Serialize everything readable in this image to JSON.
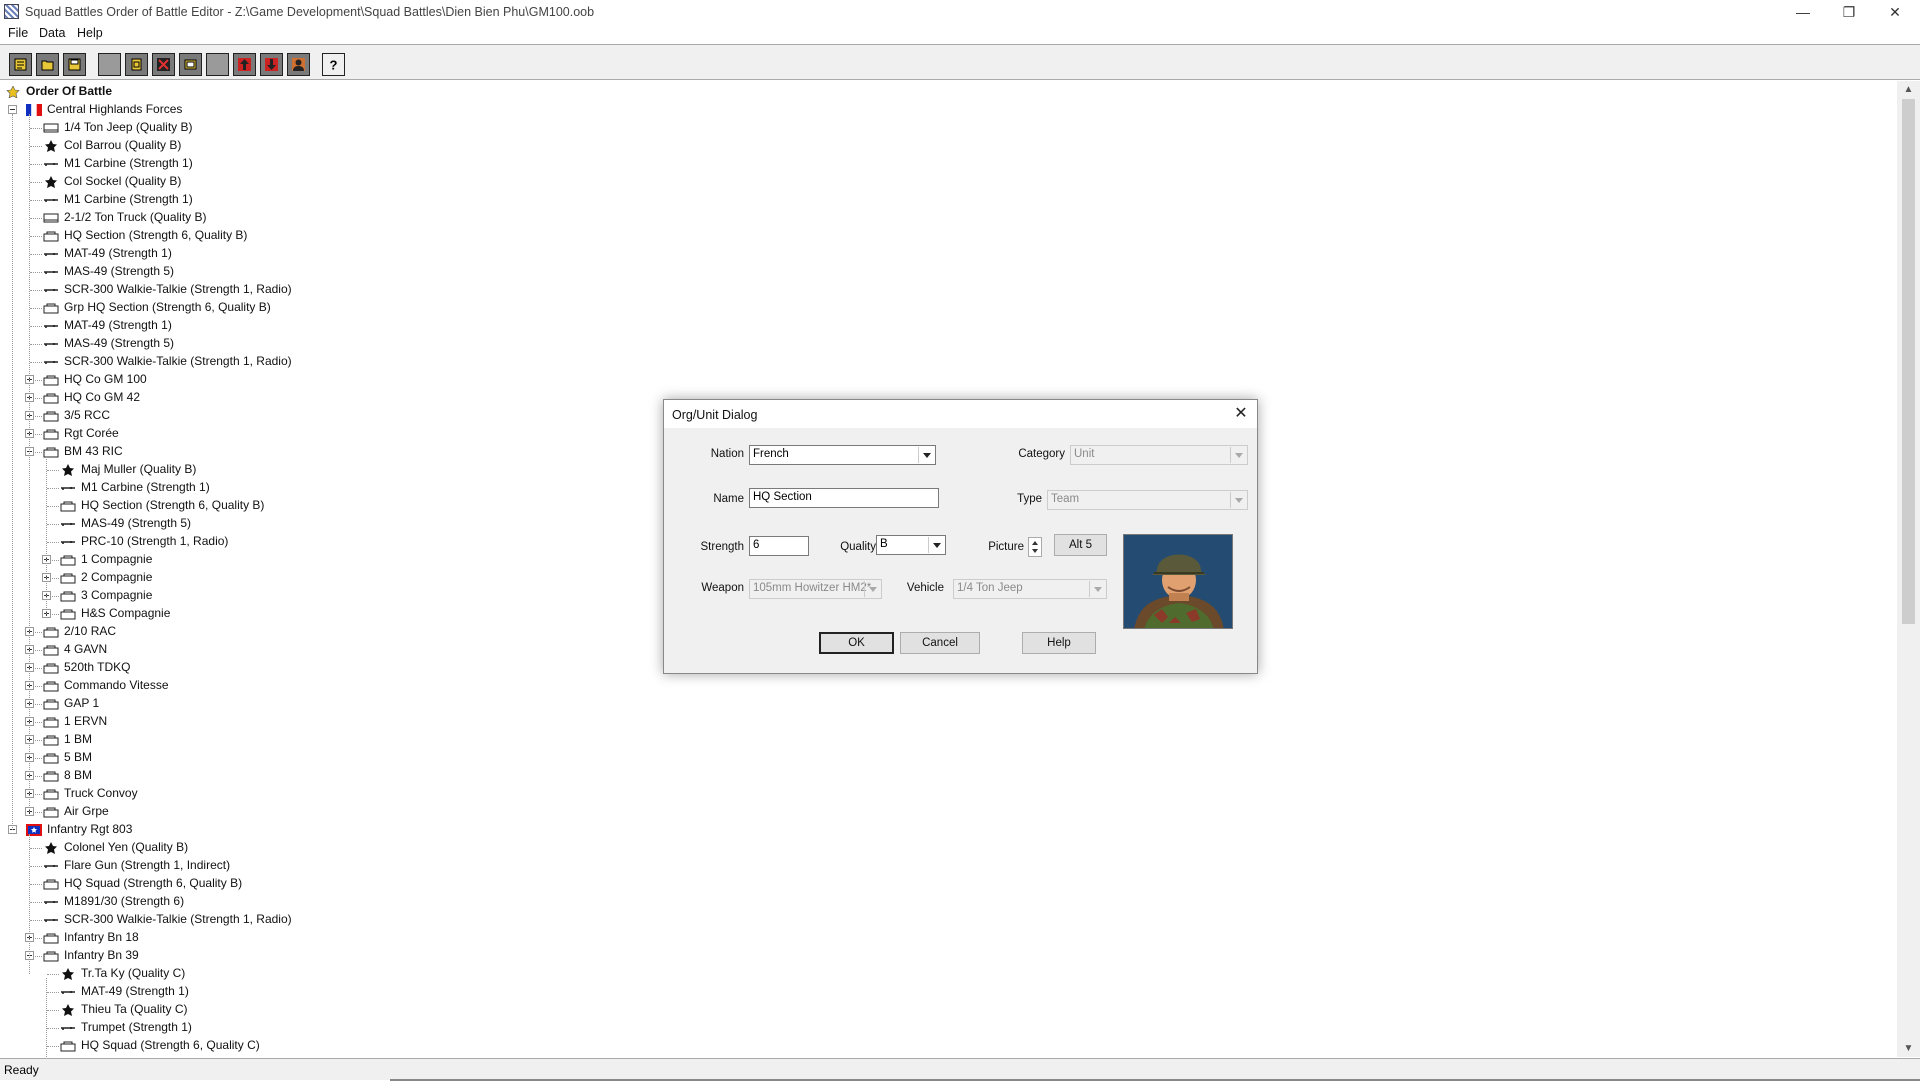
{
  "window": {
    "title": "Squad Battles Order of Battle Editor - Z:\\Game Development\\Squad Battles\\Dien Bien Phu\\GM100.oob",
    "controls": {
      "minimize": "—",
      "restore": "❐",
      "close": "✕"
    }
  },
  "menu": [
    "File",
    "Data",
    "Help"
  ],
  "toolbar": {
    "buttons": [
      "new-file-icon",
      "open-file-icon",
      "save-file-icon",
      "blank-icon",
      "document-icon",
      "delete-icon",
      "edit-icon",
      "blank-icon",
      "move-up-icon",
      "move-down-icon",
      "unit-icon",
      "help-icon"
    ]
  },
  "tree": [
    {
      "label": "Order Of Battle",
      "icon": "star-root-icon",
      "level": 0,
      "bold": true
    },
    {
      "label": "Central Highlands Forces",
      "icon": "french-flag-icon",
      "level": 0,
      "expanded": true
    },
    {
      "label": "1/4 Ton Jeep (Quality B)",
      "icon": "vehicle-icon",
      "level": 1
    },
    {
      "label": "Col Barrou (Quality B)",
      "icon": "leader-star-icon",
      "level": 1
    },
    {
      "label": "M1 Carbine (Strength 1)",
      "icon": "rifle-icon",
      "level": 1
    },
    {
      "label": "Col Sockel (Quality B)",
      "icon": "leader-star-icon",
      "level": 1
    },
    {
      "label": "M1 Carbine (Strength 1)",
      "icon": "rifle-icon",
      "level": 1
    },
    {
      "label": "2-1/2 Ton Truck (Quality B)",
      "icon": "vehicle-icon",
      "level": 1
    },
    {
      "label": "HQ Section (Strength 6, Quality B)",
      "icon": "unit-box-icon",
      "level": 1
    },
    {
      "label": "MAT-49 (Strength 1)",
      "icon": "rifle-icon",
      "level": 1
    },
    {
      "label": "MAS-49 (Strength 5)",
      "icon": "rifle-icon",
      "level": 1
    },
    {
      "label": "SCR-300 Walkie-Talkie (Strength 1, Radio)",
      "icon": "rifle-icon",
      "level": 1
    },
    {
      "label": "Grp HQ Section (Strength 6, Quality B)",
      "icon": "unit-box-icon",
      "level": 1
    },
    {
      "label": "MAT-49 (Strength 1)",
      "icon": "rifle-icon",
      "level": 1
    },
    {
      "label": "MAS-49 (Strength 5)",
      "icon": "rifle-icon",
      "level": 1
    },
    {
      "label": "SCR-300 Walkie-Talkie (Strength 1, Radio)",
      "icon": "rifle-icon",
      "level": 1
    },
    {
      "label": "HQ Co GM 100",
      "icon": "org-icon",
      "level": 1,
      "expander": "plus"
    },
    {
      "label": "HQ Co GM 42",
      "icon": "org-icon",
      "level": 1,
      "expander": "plus"
    },
    {
      "label": "3/5 RCC",
      "icon": "org-icon",
      "level": 1,
      "expander": "plus"
    },
    {
      "label": "Rgt Corée",
      "icon": "org-icon",
      "level": 1,
      "expander": "plus"
    },
    {
      "label": "BM 43 RIC",
      "icon": "org-icon",
      "level": 1,
      "expander": "minus"
    },
    {
      "label": "Maj Muller (Quality B)",
      "icon": "leader-star-icon",
      "level": 2
    },
    {
      "label": "M1 Carbine (Strength 1)",
      "icon": "rifle-icon",
      "level": 2
    },
    {
      "label": "HQ Section (Strength 6, Quality B)",
      "icon": "unit-box-icon",
      "level": 2
    },
    {
      "label": "MAS-49 (Strength 5)",
      "icon": "rifle-icon",
      "level": 2
    },
    {
      "label": "PRC-10 (Strength 1, Radio)",
      "icon": "rifle-icon",
      "level": 2
    },
    {
      "label": "1 Compagnie",
      "icon": "org-icon",
      "level": 2,
      "expander": "plus"
    },
    {
      "label": "2 Compagnie",
      "icon": "org-icon",
      "level": 2,
      "expander": "plus"
    },
    {
      "label": "3 Compagnie",
      "icon": "org-icon",
      "level": 2,
      "expander": "plus"
    },
    {
      "label": "H&S Compagnie",
      "icon": "org-icon",
      "level": 2,
      "expander": "plus"
    },
    {
      "label": "2/10 RAC",
      "icon": "org-icon",
      "level": 1,
      "expander": "plus"
    },
    {
      "label": "4 GAVN",
      "icon": "org-icon",
      "level": 1,
      "expander": "plus"
    },
    {
      "label": "520th TDKQ",
      "icon": "org-icon",
      "level": 1,
      "expander": "plus"
    },
    {
      "label": "Commando Vitesse",
      "icon": "org-icon",
      "level": 1,
      "expander": "plus"
    },
    {
      "label": "GAP 1",
      "icon": "org-icon",
      "level": 1,
      "expander": "plus"
    },
    {
      "label": "1 ERVN",
      "icon": "org-icon",
      "level": 1,
      "expander": "plus"
    },
    {
      "label": "1 BM",
      "icon": "org-icon",
      "level": 1,
      "expander": "plus"
    },
    {
      "label": "5 BM",
      "icon": "org-icon",
      "level": 1,
      "expander": "plus"
    },
    {
      "label": "8 BM",
      "icon": "org-icon",
      "level": 1,
      "expander": "plus"
    },
    {
      "label": "Truck Convoy",
      "icon": "org-icon",
      "level": 1,
      "expander": "plus"
    },
    {
      "label": "Air Grpe",
      "icon": "org-icon",
      "level": 1,
      "expander": "plus"
    },
    {
      "label": "Infantry Rgt 803",
      "icon": "viet-minh-flag-icon",
      "level": 0,
      "expanded": true
    },
    {
      "label": "Colonel Yen (Quality B)",
      "icon": "leader-star-icon",
      "level": 1
    },
    {
      "label": "Flare Gun (Strength 1, Indirect)",
      "icon": "rifle-icon",
      "level": 1
    },
    {
      "label": "HQ Squad (Strength 6, Quality B)",
      "icon": "unit-box-icon",
      "level": 1
    },
    {
      "label": "M1891/30 (Strength 6)",
      "icon": "rifle-icon",
      "level": 1
    },
    {
      "label": "SCR-300 Walkie-Talkie (Strength 1, Radio)",
      "icon": "rifle-icon",
      "level": 1
    },
    {
      "label": "Infantry Bn 18",
      "icon": "org-icon",
      "level": 1,
      "expander": "plus"
    },
    {
      "label": "Infantry Bn 39",
      "icon": "org-icon",
      "level": 1,
      "expander": "minus"
    },
    {
      "label": "Tr.Ta Ky (Quality C)",
      "icon": "leader-star-icon",
      "level": 2
    },
    {
      "label": "MAT-49 (Strength 1)",
      "icon": "rifle-icon",
      "level": 2
    },
    {
      "label": "Thieu Ta (Quality C)",
      "icon": "leader-star-icon",
      "level": 2
    },
    {
      "label": "Trumpet (Strength 1)",
      "icon": "rifle-icon",
      "level": 2
    },
    {
      "label": "HQ Squad (Strength 6, Quality C)",
      "icon": "unit-box-icon",
      "level": 2
    }
  ],
  "status": "Ready",
  "dialog": {
    "title": "Org/Unit Dialog",
    "close": "✕",
    "nation_label": "Nation",
    "nation_value": "French",
    "category_label": "Category",
    "category_value": "Unit",
    "name_label": "Name",
    "name_value": "HQ Section",
    "type_label": "Type",
    "type_value": "Team",
    "strength_label": "Strength",
    "strength_value": "6",
    "quality_label": "Quality",
    "quality_value": "B",
    "picture_label": "Picture",
    "alt_button": "Alt 5",
    "weapon_label": "Weapon",
    "weapon_value": "105mm Howitzer HM2*",
    "vehicle_label": "Vehicle",
    "vehicle_value": "1/4 Ton Jeep",
    "ok": "OK",
    "cancel": "Cancel",
    "help": "Help",
    "portrait": "soldier-portrait"
  }
}
